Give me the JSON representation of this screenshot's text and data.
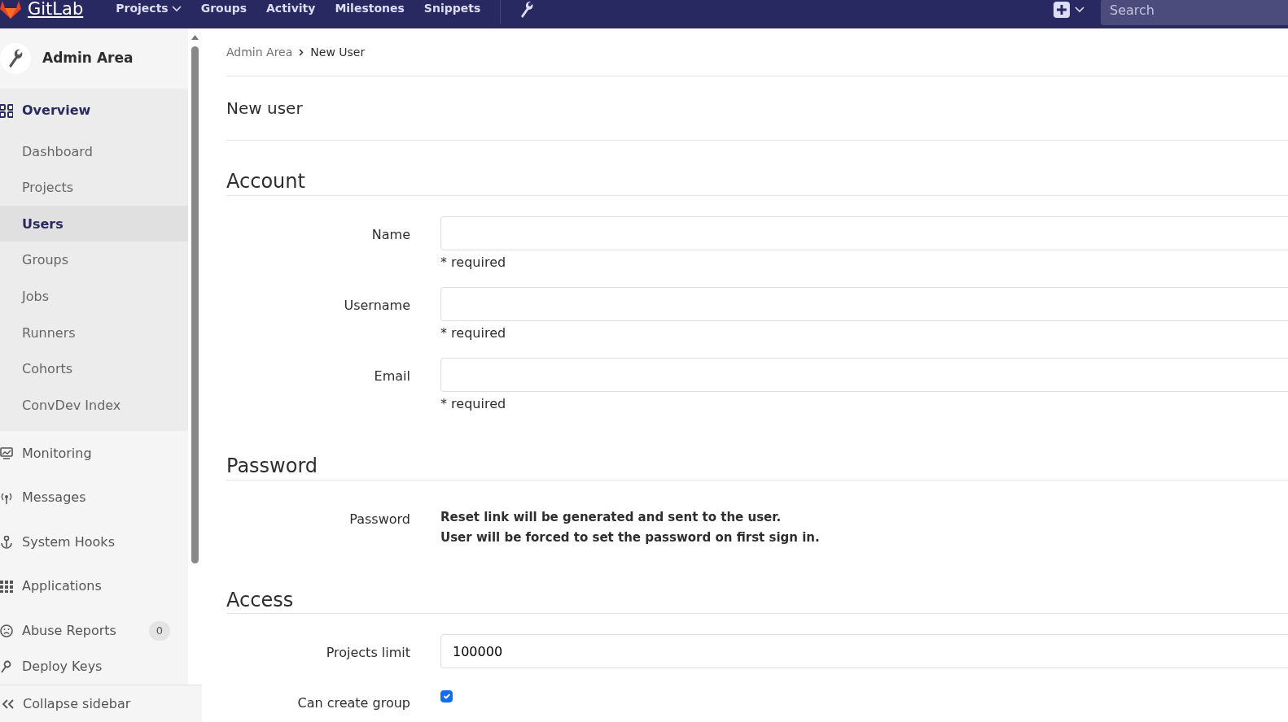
{
  "navbar": {
    "brand": "GitLab",
    "links": [
      {
        "label": "Projects",
        "dropdown": true
      },
      {
        "label": "Groups",
        "dropdown": false
      },
      {
        "label": "Activity",
        "dropdown": false
      },
      {
        "label": "Milestones",
        "dropdown": false
      },
      {
        "label": "Snippets",
        "dropdown": false
      }
    ],
    "search": {
      "placeholder": "Search"
    }
  },
  "sidebar": {
    "title": "Admin Area",
    "items": [
      {
        "label": "Overview",
        "selected": true,
        "children": [
          {
            "label": "Dashboard",
            "selected": false
          },
          {
            "label": "Projects",
            "selected": false
          },
          {
            "label": "Users",
            "selected": true
          },
          {
            "label": "Groups",
            "selected": false
          },
          {
            "label": "Jobs",
            "selected": false
          },
          {
            "label": "Runners",
            "selected": false
          },
          {
            "label": "Cohorts",
            "selected": false
          },
          {
            "label": "ConvDev Index",
            "selected": false
          }
        ]
      },
      {
        "label": "Monitoring",
        "selected": false
      },
      {
        "label": "Messages",
        "selected": false
      },
      {
        "label": "System Hooks",
        "selected": false
      },
      {
        "label": "Applications",
        "selected": false
      },
      {
        "label": "Abuse Reports",
        "selected": false,
        "badge": "0"
      },
      {
        "label": "Deploy Keys",
        "selected": false
      }
    ],
    "collapse": "Collapse sidebar"
  },
  "breadcrumb": [
    "Admin Area",
    "New User"
  ],
  "page_title": "New user",
  "sections": [
    {
      "title": "Account",
      "fields": [
        {
          "kind": "input",
          "label": "Name",
          "hint": "* required"
        },
        {
          "kind": "input",
          "label": "Username",
          "hint": "* required"
        },
        {
          "kind": "input",
          "label": "Email",
          "hint": "* required"
        }
      ]
    },
    {
      "title": "Password",
      "fields": [
        {
          "kind": "text",
          "label": "Password",
          "lines": [
            "Reset link will be generated and sent to the user.",
            "User will be forced to set the password on first sign in."
          ]
        }
      ]
    },
    {
      "title": "Access",
      "fields": [
        {
          "kind": "input",
          "label": "Projects limit",
          "value": "100000"
        },
        {
          "kind": "checkbox",
          "label": "Can create group",
          "checked": true
        }
      ]
    }
  ]
}
